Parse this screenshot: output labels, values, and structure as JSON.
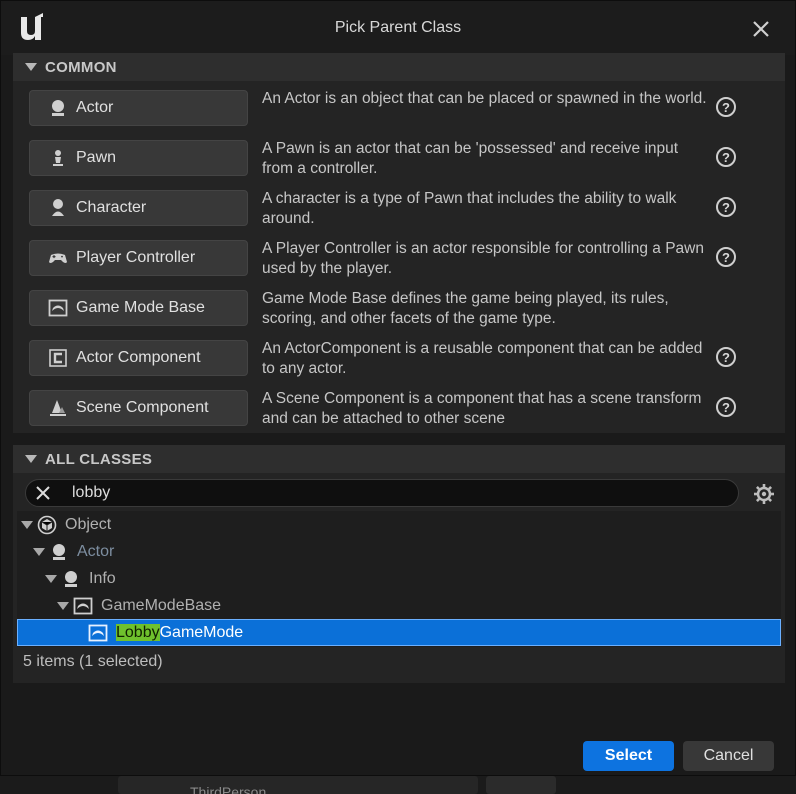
{
  "window": {
    "title": "Pick Parent Class"
  },
  "common": {
    "header": "COMMON",
    "items": [
      {
        "label": "Actor",
        "icon": "actor-icon",
        "description": "An Actor is an object that can be placed or spawned in the world."
      },
      {
        "label": "Pawn",
        "icon": "pawn-icon",
        "description": "A Pawn is an actor that can be 'possessed' and receive input from a controller."
      },
      {
        "label": "Character",
        "icon": "character-icon",
        "description": "A character is a type of Pawn that includes the ability to walk around."
      },
      {
        "label": "Player Controller",
        "icon": "gamepad-icon",
        "description": "A Player Controller is an actor responsible for controlling a Pawn used by the player."
      },
      {
        "label": "Game Mode Base",
        "icon": "game-mode-icon",
        "description": "Game Mode Base defines the game being played, its rules, scoring, and other facets of the game type."
      },
      {
        "label": "Actor Component",
        "icon": "component-icon",
        "description": "An ActorComponent is a reusable component that can be added to any actor."
      },
      {
        "label": "Scene Component",
        "icon": "scene-component-icon",
        "description": "A Scene Component is a component that has a scene transform and can be attached to other scene"
      }
    ]
  },
  "all_classes": {
    "header": "ALL CLASSES",
    "search": {
      "value": "lobby"
    },
    "tree": [
      {
        "label": "Object"
      },
      {
        "label": "Actor"
      },
      {
        "label": "Info"
      },
      {
        "label": "GameModeBase"
      },
      {
        "label_highlight": "Lobby",
        "label_rest": "GameMode",
        "selected": true
      }
    ],
    "status": "5 items (1 selected)"
  },
  "footer": {
    "select_label": "Select",
    "cancel_label": "Cancel"
  },
  "background": {
    "partial_text": "ThirdPerson"
  },
  "colors": {
    "accent": "#0d73e0",
    "selection": "#0b70d8",
    "highlight": "#6fc12d"
  }
}
